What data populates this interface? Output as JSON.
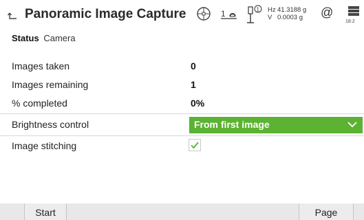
{
  "header": {
    "title": "Panoramic Image Capture",
    "back_icon": "back-arrow-icon"
  },
  "status_bar": {
    "hz_label": "Hz",
    "hz_value": "41.3188 g",
    "v_label": "V",
    "v_value": "0.0003 g",
    "mode_text": "1",
    "prism_text": "1",
    "at_symbol": "@",
    "battery_text": "18:2",
    "icons": [
      "target-icon",
      "measure-mode-icon",
      "prism-icon",
      "at-icon",
      "battery-icon"
    ]
  },
  "tabs": [
    {
      "label": "Status",
      "active": true
    },
    {
      "label": "Camera",
      "active": false
    }
  ],
  "fields": {
    "images_taken": {
      "label": "Images taken",
      "value": "0"
    },
    "images_remaining": {
      "label": "Images remaining",
      "value": "1"
    },
    "percent_completed": {
      "label": "% completed",
      "value": "0%"
    },
    "brightness_control": {
      "label": "Brightness control",
      "value": "From first image"
    },
    "image_stitching": {
      "label": "Image stitching",
      "checked": true
    }
  },
  "softkeys": {
    "start": "Start",
    "page": "Page"
  },
  "colors": {
    "accent_green": "#5cb232",
    "softkey_bar": "#e8e8e8"
  }
}
